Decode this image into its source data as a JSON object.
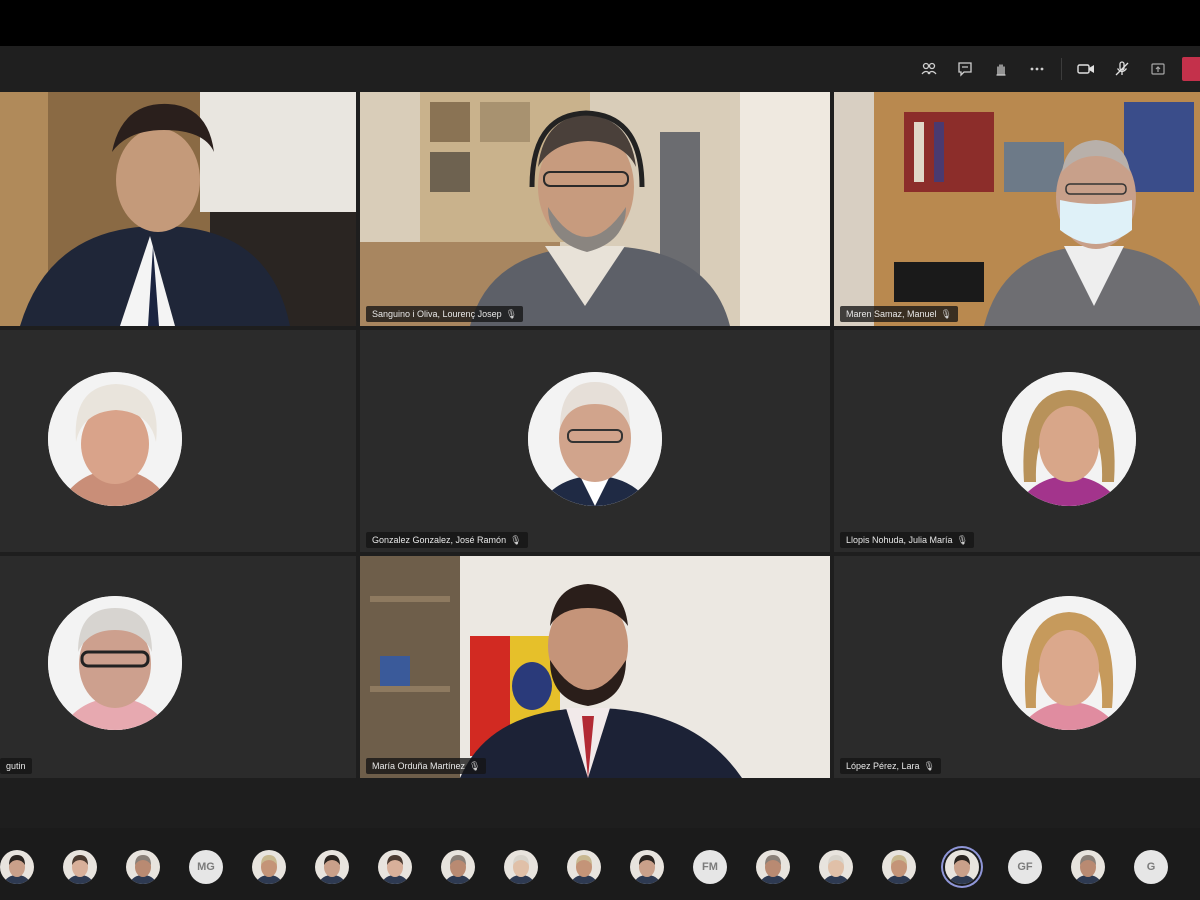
{
  "toolbar": {
    "buttons": [
      {
        "icon": "participants-icon"
      },
      {
        "icon": "chat-icon"
      },
      {
        "icon": "raise-hand-icon"
      },
      {
        "icon": "more-options-icon"
      },
      {
        "icon": "camera-icon"
      },
      {
        "icon": "mic-icon"
      },
      {
        "icon": "share-screen-icon"
      }
    ],
    "leave_color": "#c4314b"
  },
  "tiles": [
    {
      "name": "",
      "type": "video"
    },
    {
      "name": "Sanguino i Oliva, Lourenç Josep",
      "type": "video"
    },
    {
      "name": "Maren Samaz, Manuel",
      "type": "video"
    },
    {
      "name": "",
      "type": "avatar"
    },
    {
      "name": "Gonzalez Gonzalez, José Ramón",
      "type": "avatar"
    },
    {
      "name": "Llopis Nohuda, Julia María",
      "type": "avatar"
    },
    {
      "name": "gutin",
      "type": "avatar"
    },
    {
      "name": "María Orduña Martínez",
      "type": "video"
    },
    {
      "name": "López Pérez, Lara",
      "type": "avatar"
    }
  ],
  "strip": {
    "participants": [
      {
        "kind": "photo"
      },
      {
        "kind": "photo"
      },
      {
        "kind": "photo"
      },
      {
        "kind": "initials",
        "initials": "MG"
      },
      {
        "kind": "photo"
      },
      {
        "kind": "photo"
      },
      {
        "kind": "photo"
      },
      {
        "kind": "photo"
      },
      {
        "kind": "photo"
      },
      {
        "kind": "photo"
      },
      {
        "kind": "photo"
      },
      {
        "kind": "initials",
        "initials": "FM"
      },
      {
        "kind": "photo"
      },
      {
        "kind": "photo"
      },
      {
        "kind": "photo"
      },
      {
        "kind": "photo",
        "active": true
      },
      {
        "kind": "initials",
        "initials": "GF"
      },
      {
        "kind": "photo"
      },
      {
        "kind": "initials",
        "initials": "G"
      }
    ]
  },
  "colors": {
    "app_bg": "#1e1e1e",
    "tile_bg": "#2b2b2b",
    "active_ring": "#8f96d8"
  }
}
